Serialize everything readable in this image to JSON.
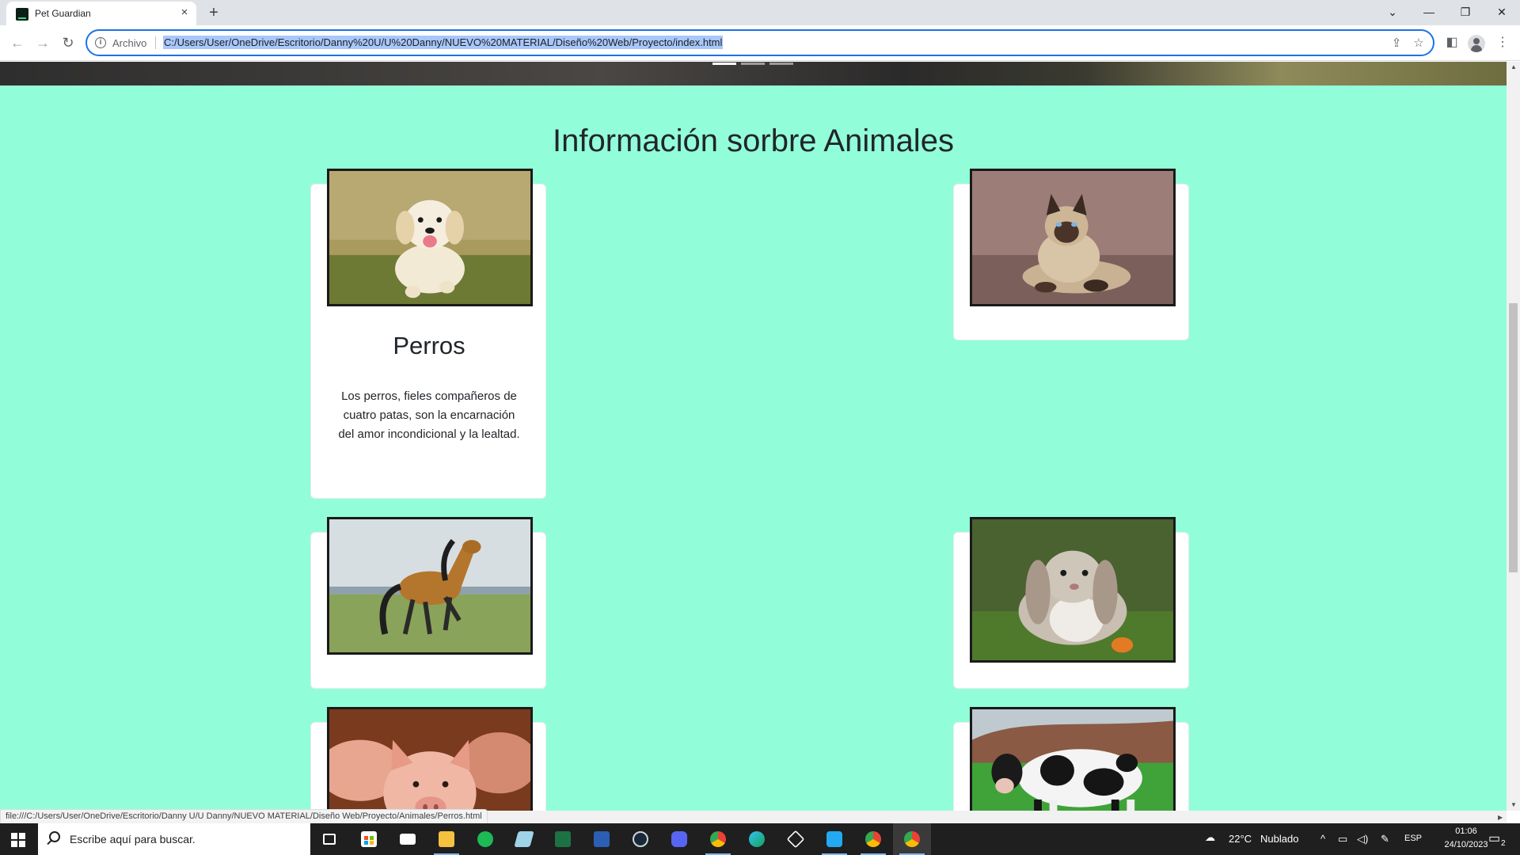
{
  "browser": {
    "tab_title": "Pet Guardian",
    "tab_close": "×",
    "new_tab": "+",
    "window_controls": {
      "tab_search": "⌄",
      "minimize": "—",
      "restore": "❐",
      "close": "✕"
    },
    "nav": {
      "back": "←",
      "forward": "→",
      "reload": "↻"
    },
    "scheme_label": "Archivo",
    "url": "C:/Users/User/OneDrive/Escritorio/Danny%20U/U%20Danny/NUEVO%20MATERIAL/Diseño%20Web/Proyecto/index.html",
    "icons": {
      "share": "⇪",
      "bookmark": "☆",
      "side_panel": "◧",
      "menu": "⋮"
    },
    "status_url": "file:///C:/Users/User/OneDrive/Escritorio/Danny U/U Danny/NUEVO MATERIAL/Diseño Web/Proyecto/Animales/Perros.html"
  },
  "page": {
    "section_title": "Información sorbre Animales",
    "carousel_indicators": 3,
    "carousel_active_index": 0,
    "cards": [
      {
        "name": "dog",
        "title": "Perros",
        "text": "Los perros, fieles compañeros de cuatro patas, son la encarnación del amor incondicional y la lealtad."
      },
      {
        "name": "cat",
        "title": "",
        "text": ""
      },
      {
        "name": "horse",
        "title": "",
        "text": ""
      },
      {
        "name": "rabbit",
        "title": "",
        "text": ""
      },
      {
        "name": "pig",
        "title": "",
        "text": ""
      },
      {
        "name": "cow",
        "title": "",
        "text": ""
      }
    ]
  },
  "taskbar": {
    "search_placeholder": "Escribe aquí para buscar.",
    "weather": {
      "temp": "22°C",
      "condition": "Nublado"
    },
    "language": "ESP",
    "time": "01:06",
    "date": "24/10/2023",
    "notifications": "2",
    "apps": [
      "task-view",
      "microsoft-store",
      "mail",
      "file-explorer",
      "spotify",
      "paint",
      "excel",
      "word",
      "steam",
      "discord",
      "chrome-profile",
      "edge",
      "unity",
      "vscode",
      "chrome-alt",
      "chrome"
    ]
  },
  "colors": {
    "page_background": "#92fed9",
    "card_background": "#ffffff",
    "text": "#212529",
    "omnibox_focus": "#1a73e8",
    "url_selection": "#a8c7fa",
    "taskbar": "#1f1f1f"
  }
}
